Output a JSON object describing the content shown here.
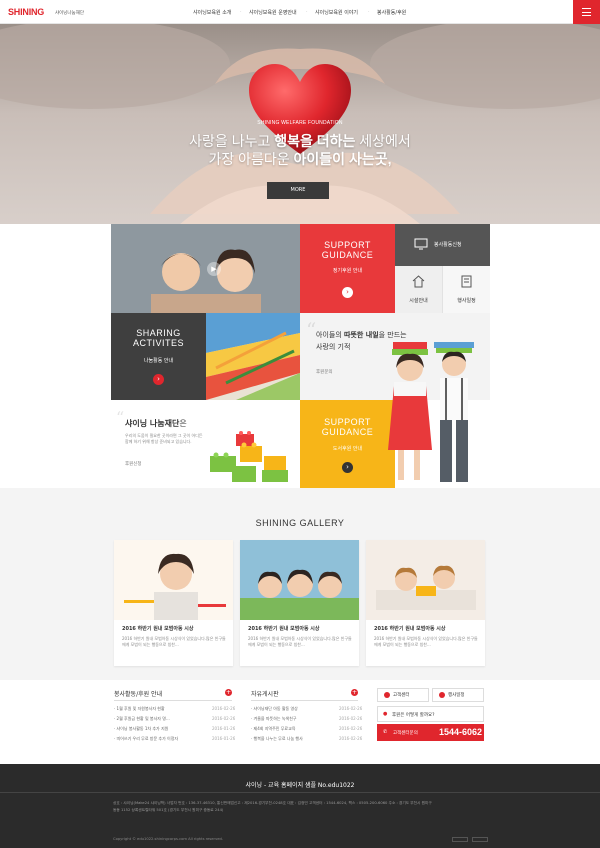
{
  "header": {
    "logo": "SHINING",
    "logo_sub": "샤이닝나눔재단",
    "nav": [
      "샤이닝보육원 소개",
      "샤이닝보육원 운영안내",
      "샤이닝보육원 이야기",
      "봉사활동/후원"
    ]
  },
  "hero": {
    "small": "SHINING WELFARE FOUNDATION",
    "line1_a": "사랑을 나누고 ",
    "line1_b": "행복을 더하는",
    "line1_c": " 세상에서",
    "line2_a": "가장 아름다운 ",
    "line2_b": "아이들이 사는곳,",
    "more": "MORE"
  },
  "tiles": {
    "support1_title_1": "SUPPORT",
    "support1_title_2": "GUIDANCE",
    "support1_sub": "정기후원 안내",
    "volunteer_apply": "봉사활동신청",
    "facility": "시설안내",
    "schedule": "행사일정",
    "sharing_title_1": "SHARING",
    "sharing_title_2": "ACTIVITES",
    "sharing_sub": "나눔활동 안내",
    "quote_a": "아이들의 ",
    "quote_b": "따뜻한 내일",
    "quote_c": "을 만드는",
    "quote_line2": "사랑의 기적",
    "quote_link": "후원문의",
    "foundation_a": "샤이닝 나눔재단",
    "foundation_b": "은",
    "foundation_desc": "우리의 도움이 필요한 곳이라면 그 곳이 어디든 함께 하기 위해 항상 준비되고 있습니다.",
    "foundation_link": "후원신청",
    "support2_title_1": "SUPPORT",
    "support2_title_2": "GUIDANCE",
    "support2_sub": "도서후원 안내"
  },
  "gallery": {
    "title": "SHINING GALLERY",
    "items": [
      {
        "caption": "2016 하반기 원내 모범아동 시상",
        "desc": "2016 하반기 원내 모범아동 시상식이 있었습니다.많은 친구들에게 모범이 되는 행동으로 칭찬..."
      },
      {
        "caption": "2016 하반기 원내 모범아동 시상",
        "desc": "2016 하반기 원내 모범아동 시상식이 있었습니다.많은 친구들에게 모범이 되는 행동으로 칭찬..."
      },
      {
        "caption": "2016 하반기 원내 모범아동 시상",
        "desc": "2016 하반기 원내 모범아동 시상식이 있었습니다.많은 친구들에게 모범이 되는 행동으로 칭찬..."
      }
    ]
  },
  "boards": {
    "left_title": "봉사활동/후원 안내",
    "left_rows": [
      {
        "text": "· 1월 후원 및 자원봉사자 현황",
        "date": "2016-02-26"
      },
      {
        "text": "· 2월 후원금 현황 및 봉사자 명...",
        "date": "2016-02-26"
      },
      {
        "text": "· 샤이닝 봉사활동 1차 추가 지원",
        "date": "2016-01-26"
      },
      {
        "text": "· 띄어쓰기 우리 무료 방문 추가 이정자",
        "date": "2016-01-26"
      }
    ],
    "right_title": "자유게시판",
    "right_rows": [
      {
        "text": "· 샤이닝재단 아동 활동 영상",
        "date": "2016-02-26"
      },
      {
        "text": "· 겨울을 따뜻하는 녹색친구",
        "date": "2016-02-26"
      },
      {
        "text": "· 제4회 지역주민 무료교육",
        "date": "2016-02-26"
      },
      {
        "text": "· 행복을 나누는 무료 나눔 행사",
        "date": "2016-02-26"
      }
    ]
  },
  "sidebox": {
    "customer": "고객센터",
    "event": "행사일정",
    "question": "후원은 어떻게 할까요?",
    "phone_label": "고객센터문의",
    "phone": "1544-6062"
  },
  "footer": {
    "title": "샤이닝 - 교육 홈페이지 샘플 No.edu1022",
    "info_1": "상호 : 샤이닝(Make24 샤이닝학) 사업자 번호 : 136-37-46310, 통신판매업신고 : 제2016-경기부천-0248호 대표 : 김정민 고객센터 : 1544-6024, 팩스 : 0505-200-6060 주소 : 경기도 부천시 원미구",
    "info_2": "동동 1152 상록센트럴타워 501호 (경기도 부천시 원미구 중동로 244)",
    "copyright": "Copyright © edu1022.shiningcorps.com All rights reserved."
  },
  "colors": {
    "brand": "#e0262d",
    "yellow": "#f7b518",
    "dark": "#3a3a3a",
    "gray": "#555555"
  }
}
